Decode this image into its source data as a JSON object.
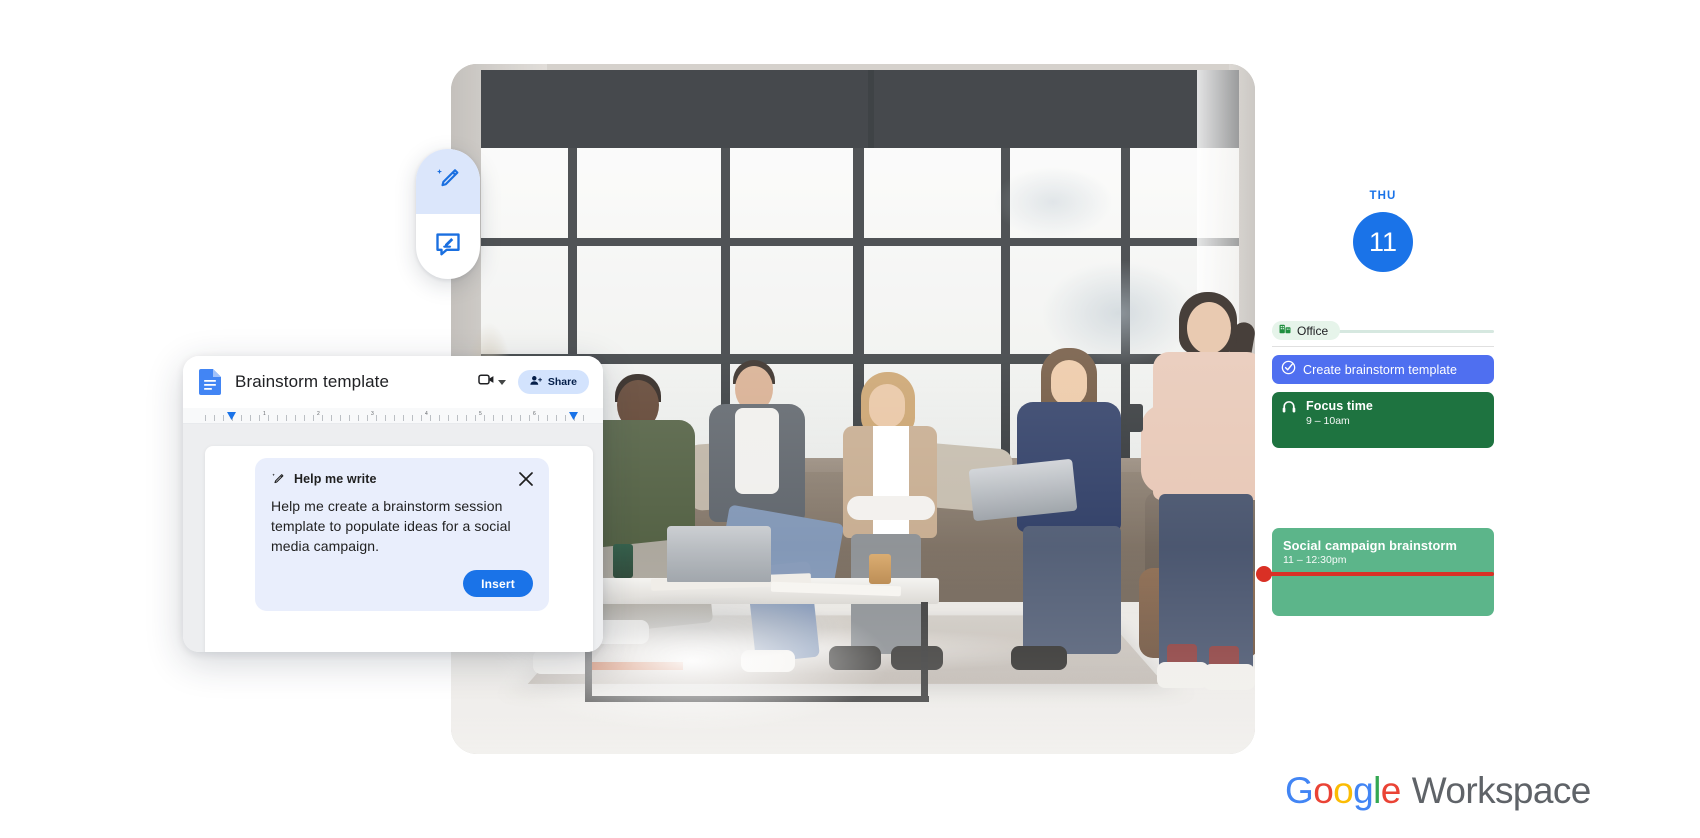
{
  "brand": {
    "logo_parts": [
      "G",
      "o",
      "o",
      "g",
      "l",
      "e"
    ],
    "product": "Workspace",
    "colors": {
      "blue": "#4285F4",
      "red": "#EA4335",
      "yellow": "#FBBC04",
      "green": "#34A853",
      "grey": "#5f6368"
    }
  },
  "docs": {
    "file_icon": "google-docs-icon",
    "title": "Brainstorm template",
    "camera_icon": "video-camera-icon",
    "camera_caret": "chevron-down-icon",
    "share": {
      "icon": "person-add-icon",
      "label": "Share"
    },
    "ruler": {
      "numbers": [
        "1",
        "2",
        "3",
        "4",
        "5",
        "6"
      ]
    },
    "help_me_write": {
      "icon": "magic-pencil-icon",
      "title": "Help me write",
      "close_icon": "close-icon",
      "prompt": "Help me create a brainstorm session template to populate ideas for a social media campaign.",
      "insert_label": "Insert"
    }
  },
  "side_toolbar": {
    "items": [
      {
        "icon": "magic-pencil-icon",
        "name": "help-me-write",
        "active": true
      },
      {
        "icon": "comment-edit-icon",
        "name": "add-comment",
        "active": false
      }
    ]
  },
  "photo": {
    "alt": "Five colleagues collaborating on a couch in a bright office lounge with large windows",
    "name": "office-collaboration-photo"
  },
  "calendar": {
    "day_of_week": "THU",
    "day_number": "11",
    "working_location": {
      "icon": "office-building-icon",
      "label": "Office"
    },
    "events": [
      {
        "type": "task",
        "icon": "check-circle-icon",
        "title": "Create brainstorm template",
        "time": "",
        "color": "#4f6ff0"
      },
      {
        "type": "focus",
        "icon": "headphones-icon",
        "title": "Focus time",
        "time": "9 – 10am",
        "color": "#1e7340"
      },
      {
        "type": "meeting",
        "icon": "",
        "title": "Social campaign brainstorm",
        "time": "11 – 12:30pm",
        "color": "#5cb58a"
      }
    ],
    "current_time_indicator": {
      "name": "current-time-line",
      "color": "#d93025"
    }
  }
}
